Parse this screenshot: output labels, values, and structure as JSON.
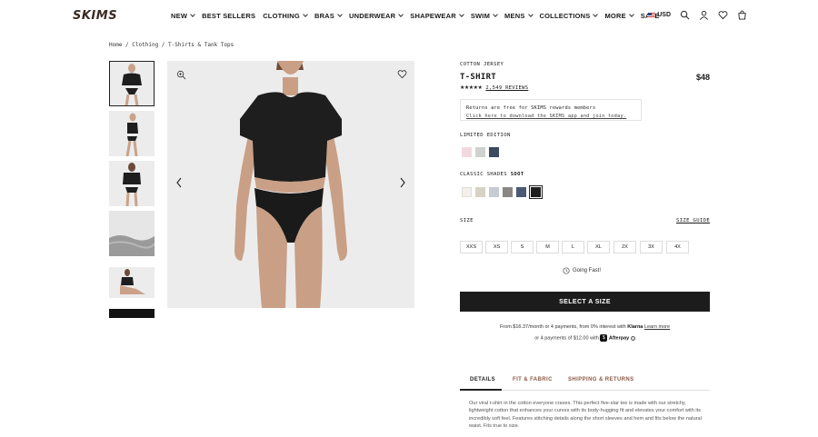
{
  "header": {
    "logo": "SKIMS",
    "nav": [
      {
        "label": "NEW",
        "has_dropdown": true
      },
      {
        "label": "BEST SELLERS",
        "has_dropdown": false
      },
      {
        "label": "CLOTHING",
        "has_dropdown": true
      },
      {
        "label": "BRAS",
        "has_dropdown": true
      },
      {
        "label": "UNDERWEAR",
        "has_dropdown": true
      },
      {
        "label": "SHAPEWEAR",
        "has_dropdown": true
      },
      {
        "label": "SWIM",
        "has_dropdown": true
      },
      {
        "label": "MENS",
        "has_dropdown": true
      },
      {
        "label": "COLLECTIONS",
        "has_dropdown": true
      },
      {
        "label": "MORE",
        "has_dropdown": true
      },
      {
        "label": "SALE",
        "has_dropdown": false
      }
    ],
    "currency": "USD",
    "icons": [
      "us-flag-icon",
      "search-icon",
      "account-icon",
      "heart-icon",
      "bag-icon"
    ]
  },
  "breadcrumb": "Home / Clothing / T-Shirts & Tank Tops",
  "product": {
    "collection": "COTTON JERSEY",
    "title": "T-SHIRT",
    "price": "$48",
    "stars": "★★★★★",
    "reviews": "2,549 REVIEWS",
    "promo_line1": "Returns are free for SKIMS rewards members",
    "promo_line2": "Click here to download the SKIMS app and join today.",
    "limited_label": "LIMITED EDITION",
    "limited_swatches": [
      "#f3d9df",
      "#cfd2d1",
      "#3b4a5e"
    ],
    "classic_label": "CLASSIC SHADES",
    "classic_selected": "SOOT",
    "classic_swatches": [
      "#f3f0ea",
      "#d8d2c4",
      "#c7ccd2",
      "#8a8785",
      "#4a5a74",
      "#1f1f1f"
    ],
    "size_label": "SIZE",
    "size_guide": "SIZE GUIDE",
    "sizes": [
      "XXS",
      "XS",
      "S",
      "M",
      "L",
      "XL",
      "2X",
      "3X",
      "4X"
    ],
    "going_fast": "Going Fast!",
    "cta": "SELECT A SIZE",
    "klarna_pre": "From $16.37/month or 4 payments, from 0% interest with",
    "klarna_brand": "Klarna",
    "klarna_link": "Learn more",
    "afterpay_pre": "or 4 payments of $12.00 with",
    "afterpay_brand": "Afterpay",
    "tabs": [
      "DETAILS",
      "FIT & FABRIC",
      "SHIPPING & RETURNS"
    ],
    "active_tab": "DETAILS",
    "description": "Our viral t-shirt in the cotton everyone craves. This perfect five-star tee is made with our stretchy, lightweight cotton that enhances your curves with its body-hugging fit and elevates your comfort with its incredibly soft feel. Features stitching details along the short sleeves and hem and fits below the natural waist. Fits true to size."
  },
  "colors": {
    "brand": "#3a2a24",
    "cta_bg": "#1c1c1c",
    "tab_inactive": "#8a5a44",
    "image_bg": "#ececec"
  }
}
